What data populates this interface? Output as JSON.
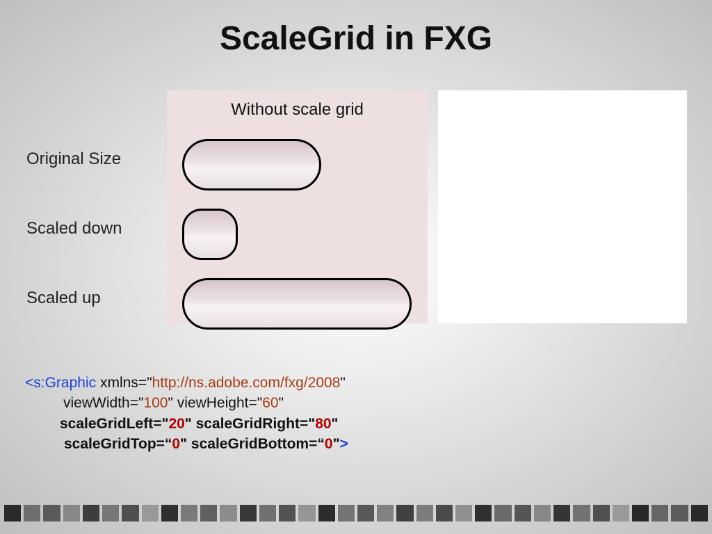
{
  "title": "ScaleGrid in FXG",
  "labels": {
    "original": "Original Size",
    "down": "Scaled down",
    "up": "Scaled up"
  },
  "panel": {
    "left_title": "Without scale grid"
  },
  "code": {
    "tag_open": "<s:Graphic",
    "xmlns_attr": " xmlns=\"",
    "xmlns_val": "http://ns.adobe.com/fxg/2008",
    "q": "\"",
    "viewWidth_attr": "viewWidth=\"",
    "viewWidth_val": "100",
    "viewHeight_attr": "\" viewHeight=\"",
    "viewHeight_val": "60",
    "sgl_attr": "scaleGridLeft=\"",
    "sgl_val": "20",
    "sgr_attr": "\" scaleGridRight=\"",
    "sgr_val": "80",
    "sgt_attr": "scaleGridTop=“",
    "sgt_val": "0",
    "sgb_attr": "\" scaleGridBottom=“",
    "sgb_val": "0",
    "close": ">"
  },
  "strip_shades": [
    "#2a2a2a",
    "#6f6f6f",
    "#5a5a5a",
    "#888",
    "#3d3d3d",
    "#777",
    "#4f4f4f",
    "#999",
    "#2f2f2f",
    "#7a7a7a",
    "#606060",
    "#8c8c8c",
    "#383838",
    "#707070",
    "#525252",
    "#969696",
    "#2c2c2c",
    "#747474",
    "#585858",
    "#828282",
    "#404040",
    "#7d7d7d",
    "#4a4a4a",
    "#909090",
    "#303030",
    "#6a6a6a",
    "#555",
    "#878787",
    "#353535",
    "#727272",
    "#505050",
    "#9a9a9a",
    "#282828",
    "#666",
    "#5c5c5c",
    "#2a2a2a"
  ]
}
